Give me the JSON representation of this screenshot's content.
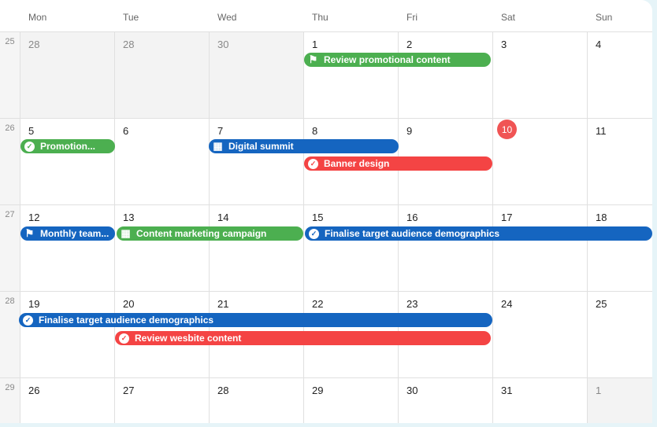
{
  "days": [
    "Mon",
    "Tue",
    "Wed",
    "Thu",
    "Fri",
    "Sat",
    "Sun"
  ],
  "weeks": [
    {
      "num": "25",
      "dates": [
        "28",
        "28",
        "30",
        "1",
        "2",
        "3",
        "4"
      ]
    },
    {
      "num": "26",
      "dates": [
        "5",
        "6",
        "7",
        "8",
        "9",
        "10",
        "11"
      ]
    },
    {
      "num": "27",
      "dates": [
        "12",
        "13",
        "14",
        "15",
        "16",
        "17",
        "18"
      ]
    },
    {
      "num": "28",
      "dates": [
        "19",
        "20",
        "21",
        "22",
        "23",
        "24",
        "25"
      ]
    },
    {
      "num": "29",
      "dates": [
        "26",
        "27",
        "28",
        "29",
        "30",
        "31",
        "1"
      ]
    }
  ],
  "today": "10",
  "colors": {
    "green": "#4caf50",
    "blue": "#1565c0",
    "red": "#f44444",
    "today": "#f05454"
  },
  "events": [
    {
      "label": "Review promotional content",
      "color": "green",
      "icon": "flag-icon"
    },
    {
      "label": "Promotion...",
      "color": "green",
      "icon": "check-circle-icon"
    },
    {
      "label": "Digital summit",
      "color": "blue",
      "icon": "calendar-icon"
    },
    {
      "label": "Banner design",
      "color": "red",
      "icon": "check-circle-icon"
    },
    {
      "label": "Monthly team...",
      "color": "blue",
      "icon": "flag-icon"
    },
    {
      "label": "Content marketing campaign",
      "color": "green",
      "icon": "calendar-icon"
    },
    {
      "label": "Finalise target audience demographics",
      "color": "blue",
      "icon": "check-circle-icon"
    },
    {
      "label": "Finalise target audience demographics",
      "color": "blue",
      "icon": "check-circle-icon"
    },
    {
      "label": "Review wesbite content",
      "color": "red",
      "icon": "check-circle-icon"
    }
  ]
}
